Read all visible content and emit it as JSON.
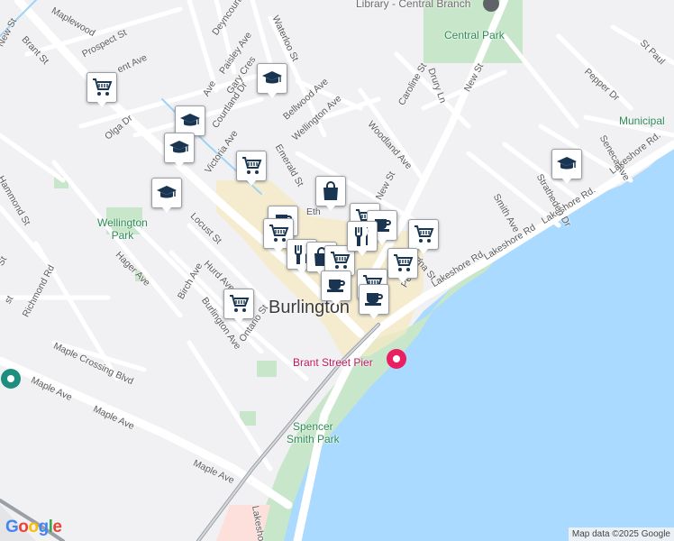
{
  "map": {
    "colors": {
      "water": "#aadaff",
      "park": "#c8e6c9",
      "land": "#f1f1f4",
      "road": "#ffffff",
      "highlight": "#f5e9c4",
      "marker_icon": "#1a3552"
    },
    "labels": {
      "library": "Library - Central Branch",
      "central_park": "Central Park",
      "municipal": "Municipal",
      "wellington_park": "Wellington\nPark",
      "burlington": "Burlington",
      "pier": "Brant Street Pier",
      "spencer_smith": "Spencer\nSmith Park",
      "brant_st": "Brant St",
      "maplewood": "Maplewood",
      "prospect_st": "Prospect St",
      "new_st_top": "New St",
      "deyncourt": "Deyncourt",
      "waterloo_st": "Waterloo St",
      "paisley_ave": "Paisley Ave",
      "gary_cres": "Gary Cres",
      "courtland_dr": "Courtland Dr",
      "olga_dr": "Olga Dr",
      "victoria_ave": "Victoria Ave",
      "emerald_st": "Emerald St",
      "bellwood_ave": "Bellwood Ave",
      "wellington_ave": "Wellington Ave",
      "woodland_ave": "Woodland Ave",
      "caroline_st": "Caroline St",
      "drury_ln": "Drury Ln",
      "new_st": "New St",
      "st_paul": "St Paul",
      "pepper_dr": "Pepper Dr",
      "seneca_ave": "Seneca Ave",
      "lakeshore_rd_1": "Lakeshore Rd",
      "lakeshore_rd_2": "Lakeshore Rd",
      "lakeshore_rd_3": "Lakeshore Rd.",
      "lakeshore_rd_4": "Lakeshore Rd.",
      "stratheden_dr": "Stratheden Dr",
      "smith_ave": "Smith Ave",
      "hammond_st": "Hammond St",
      "locust_st": "Locust St",
      "hager_ave": "Hager Ave",
      "birch_ave": "Birch Ave",
      "hurd_ave": "Hurd Ave",
      "burlington_ave": "Burlington Ave",
      "ontario_st": "Ontario St",
      "richmond_rd": "Richmond Rd",
      "maple_crossing": "Maple Crossing Blvd",
      "maple_ave_1": "Maple Ave",
      "maple_ave_2": "Maple Ave",
      "maple_ave_3": "Maple Ave",
      "pearl_st": "Pearl St",
      "elizabeth_st": "ena St",
      "lakeshore_vert": "Lakesho",
      "ent_ave": "ent Ave",
      "ave_small": "Ave",
      "st_small": "St",
      "st_small_2": "st",
      "eth": "Eth"
    },
    "markers": [
      {
        "type": "shopping-cart"
      },
      {
        "type": "school"
      },
      {
        "type": "school"
      },
      {
        "type": "school"
      },
      {
        "type": "school"
      },
      {
        "type": "shopping-cart"
      },
      {
        "type": "shopping-bag"
      },
      {
        "type": "cafe"
      },
      {
        "type": "shopping-cart"
      },
      {
        "type": "shopping-cart"
      },
      {
        "type": "cafe"
      },
      {
        "type": "restaurant"
      },
      {
        "type": "shopping-bag"
      },
      {
        "type": "shopping-cart"
      },
      {
        "type": "shopping-cart"
      },
      {
        "type": "restaurant"
      },
      {
        "type": "shopping-cart"
      },
      {
        "type": "shopping-cart"
      },
      {
        "type": "cafe"
      },
      {
        "type": "cafe"
      },
      {
        "type": "shopping-cart"
      },
      {
        "type": "school"
      }
    ],
    "logo": "Google",
    "attribution": "Map data ©2025 Google"
  }
}
